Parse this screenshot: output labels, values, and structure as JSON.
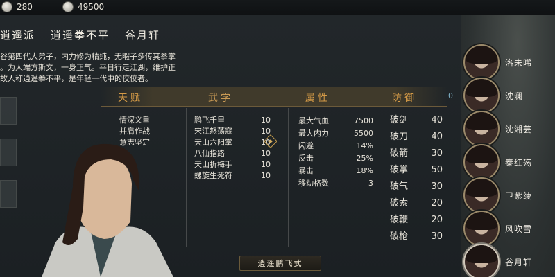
{
  "topbar": {
    "currency1": {
      "icon": "silver-coin-icon",
      "value": "280"
    },
    "currency2": {
      "icon": "gold-coin-icon",
      "value": "49500"
    }
  },
  "character": {
    "sect": "逍遥派",
    "title": "逍遥拳不平",
    "name": "谷月轩",
    "description": [
      "谷第四代大弟子，内力修为精纯，无暇子多传其拳掌",
      "。为人端方斯文，一身正气。平日行走江湖，维护正",
      "故人称逍遥拳不平，是年轻一代中的佼佼者。"
    ]
  },
  "tabs": [
    {
      "label": "天赋"
    },
    {
      "label": "武学"
    },
    {
      "label": "属性"
    },
    {
      "label": "防御"
    }
  ],
  "tab_count": "0",
  "talents": [
    "情深义重",
    "并肩作战",
    "意志坚定"
  ],
  "martial": [
    {
      "name": "鹏飞千里",
      "level": "10"
    },
    {
      "name": "宋江怒荡寇",
      "level": "10"
    },
    {
      "name": "天山六阳掌",
      "level": "10"
    },
    {
      "name": "八仙指路",
      "level": "10"
    },
    {
      "name": "天山折梅手",
      "level": "10"
    },
    {
      "name": "螺旋生死符",
      "level": "10"
    }
  ],
  "attributes": [
    {
      "name": "最大气血",
      "value": "7500"
    },
    {
      "name": "最大内力",
      "value": "5500"
    },
    {
      "name": "闪避",
      "value": "14%"
    },
    {
      "name": "反击",
      "value": "25%"
    },
    {
      "name": "暴击",
      "value": "18%"
    },
    {
      "name": "移动格数",
      "value": "3"
    }
  ],
  "defense": [
    {
      "name": "破剑",
      "value": "40"
    },
    {
      "name": "破刀",
      "value": "40"
    },
    {
      "name": "破箭",
      "value": "30"
    },
    {
      "name": "破掌",
      "value": "50"
    },
    {
      "name": "破气",
      "value": "30"
    },
    {
      "name": "破索",
      "value": "20"
    },
    {
      "name": "破鞭",
      "value": "20"
    },
    {
      "name": "破枪",
      "value": "30"
    }
  ],
  "skill_button": "逍遥鹏飞式",
  "roster": [
    {
      "name": "洛未晞"
    },
    {
      "name": "沈澜"
    },
    {
      "name": "沈湘芸"
    },
    {
      "name": "秦红殇"
    },
    {
      "name": "卫紫绫"
    },
    {
      "name": "风吹雪"
    },
    {
      "name": "谷月轩"
    }
  ]
}
